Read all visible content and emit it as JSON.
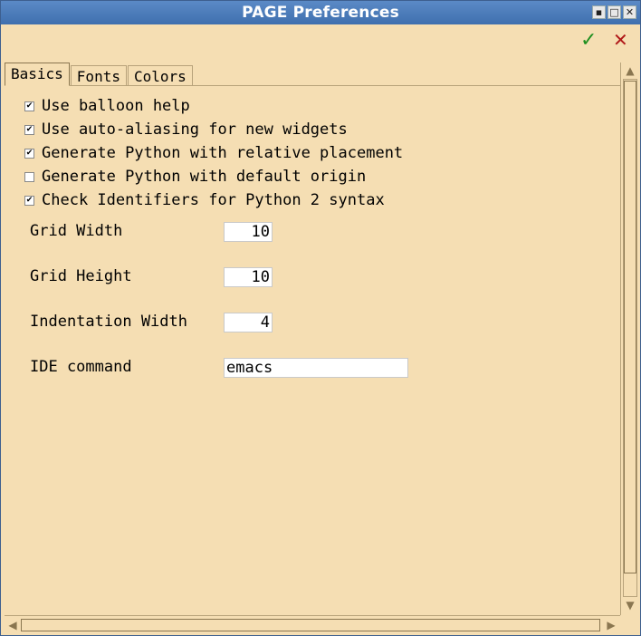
{
  "window": {
    "title": "PAGE Preferences"
  },
  "wm": {
    "minimize": "▪",
    "maximize": "□",
    "close": "✕"
  },
  "toolbar": {
    "ok_glyph": "✓",
    "cancel_glyph": "✕"
  },
  "tabs": [
    {
      "label": "Basics",
      "active": true
    },
    {
      "label": "Fonts",
      "active": false
    },
    {
      "label": "Colors",
      "active": false
    }
  ],
  "basics": {
    "checkboxes": [
      {
        "label": "Use balloon help",
        "checked": true
      },
      {
        "label": "Use auto-aliasing for new widgets",
        "checked": true
      },
      {
        "label": "Generate Python with relative placement",
        "checked": true
      },
      {
        "label": "Generate Python with default origin",
        "checked": false
      },
      {
        "label": "Check Identifiers for Python 2 syntax",
        "checked": true
      }
    ],
    "fields": [
      {
        "label": "Grid Width",
        "value": "10"
      },
      {
        "label": "Grid Height",
        "value": "10"
      },
      {
        "label": "Indentation Width",
        "value": "4"
      },
      {
        "label": "IDE command",
        "value": "emacs"
      }
    ]
  },
  "scroll": {
    "up": "▲",
    "down": "▼",
    "left": "◀",
    "right": "▶"
  }
}
